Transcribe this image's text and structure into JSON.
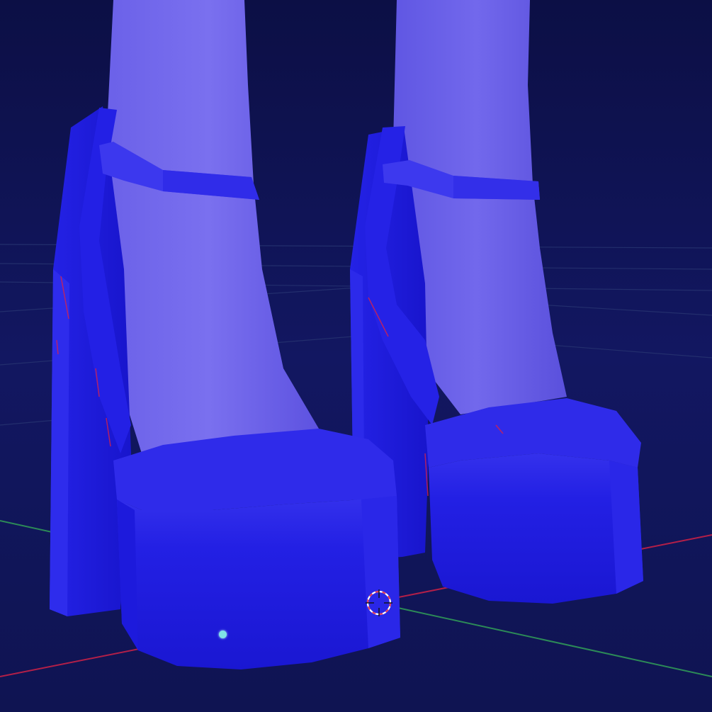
{
  "viewport": {
    "description_visible_text": [],
    "colors": {
      "background_top": "#0d1046",
      "background_bottom": "#141a63",
      "grid_line": "#22306e",
      "x_axis": "#b8204a",
      "y_axis": "#2e8a55",
      "shoe": "#1f1de6",
      "shoe_highlight": "#3a36ef",
      "shoe_shadow": "#1714c4",
      "leg": "#6a5fe6",
      "leg_light": "#7f74ee",
      "cursor_ring_red": "#e23b5c",
      "cursor_ring_white": "#ffffff",
      "origin_dot": "#7fe3e6"
    },
    "icons": {
      "cursor": "3d-cursor-icon",
      "origin": "object-origin-icon"
    }
  }
}
